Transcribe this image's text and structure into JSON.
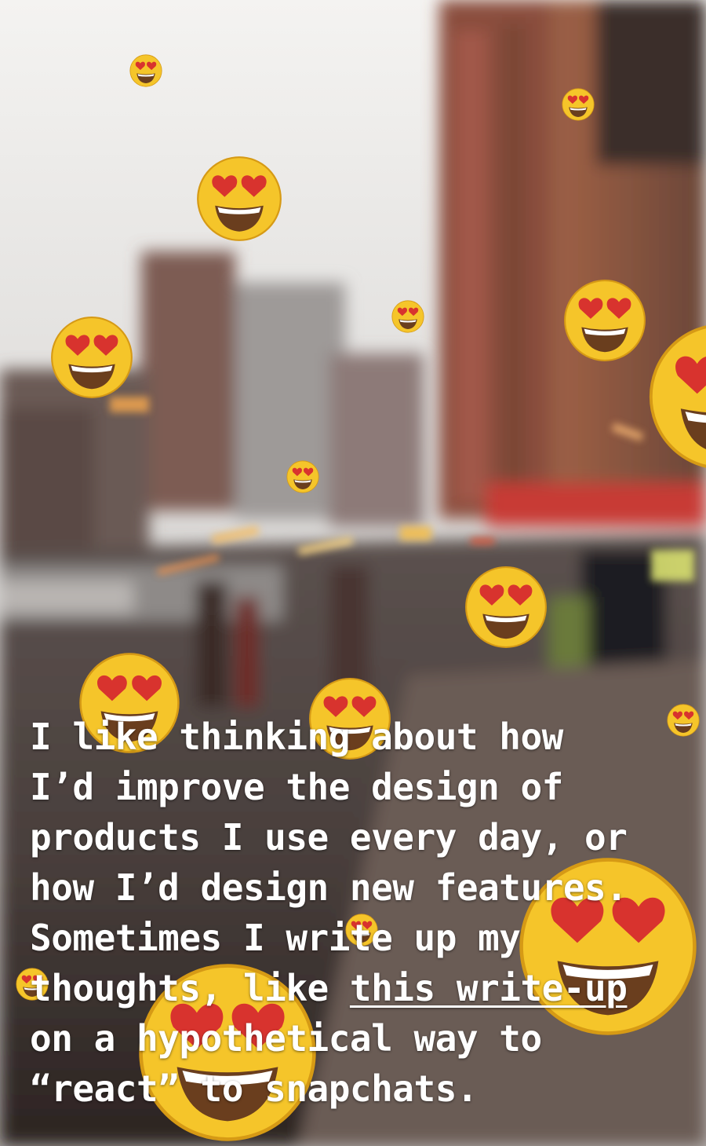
{
  "caption": {
    "line1": "I like thinking about how",
    "line2": "I’d improve the design of",
    "line3": "products I use every day, or",
    "line4": "how I’d design new features.",
    "line5": "Sometimes I write up my",
    "line6_prefix": "thoughts, like ",
    "line6_link": "this write-up",
    "line7": "on a hypothetical way to",
    "line8": "“react” to snapchats."
  },
  "overlay": {
    "emoji_icon": "heart-eyes-face-icon",
    "text_color": "#ffffff"
  },
  "background": {
    "scene": "blurred-city-street-photo"
  }
}
